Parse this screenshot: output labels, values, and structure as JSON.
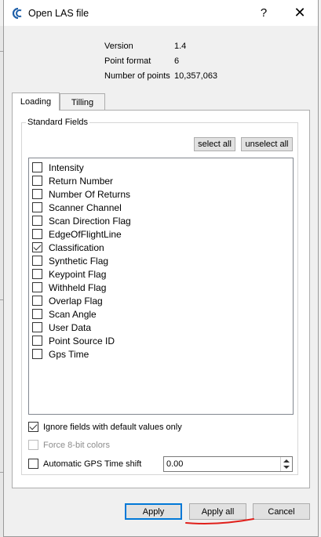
{
  "dialog": {
    "title": "Open LAS file",
    "help_glyph": "?",
    "close_glyph": "✕"
  },
  "info": {
    "version_label": "Version",
    "version_value": "1.4",
    "point_format_label": "Point format",
    "point_format_value": "6",
    "num_points_label": "Number of points",
    "num_points_value": "10,357,063"
  },
  "tabs": [
    {
      "label": "Loading",
      "active": true
    },
    {
      "label": "Tilling",
      "active": false
    }
  ],
  "standard_fields": {
    "group_title": "Standard Fields",
    "select_all_label": "select all",
    "unselect_all_label": "unselect all",
    "items": [
      {
        "label": "Intensity",
        "checked": false
      },
      {
        "label": "Return Number",
        "checked": false
      },
      {
        "label": "Number Of Returns",
        "checked": false
      },
      {
        "label": "Scanner Channel",
        "checked": false
      },
      {
        "label": "Scan Direction Flag",
        "checked": false
      },
      {
        "label": "EdgeOfFlightLine",
        "checked": false
      },
      {
        "label": "Classification",
        "checked": true
      },
      {
        "label": "Synthetic Flag",
        "checked": false
      },
      {
        "label": "Keypoint Flag",
        "checked": false
      },
      {
        "label": "Withheld Flag",
        "checked": false
      },
      {
        "label": "Overlap Flag",
        "checked": false
      },
      {
        "label": "Scan Angle",
        "checked": false
      },
      {
        "label": "User Data",
        "checked": false
      },
      {
        "label": "Point Source ID",
        "checked": false
      },
      {
        "label": "Gps Time",
        "checked": false
      }
    ]
  },
  "options": {
    "ignore_defaults_label": "Ignore fields with default values only",
    "ignore_defaults_checked": true,
    "force_8bit_label": "Force 8-bit colors",
    "force_8bit_checked": false,
    "gps_shift_label": "Automatic GPS Time shift",
    "gps_shift_checked": false,
    "gps_shift_value": "0.00"
  },
  "buttons": {
    "apply": "Apply",
    "apply_all": "Apply all",
    "cancel": "Cancel"
  },
  "colors": {
    "accent": "#0078d7",
    "annotation": "#e0201b",
    "app_icon": "#1e5fa8"
  }
}
